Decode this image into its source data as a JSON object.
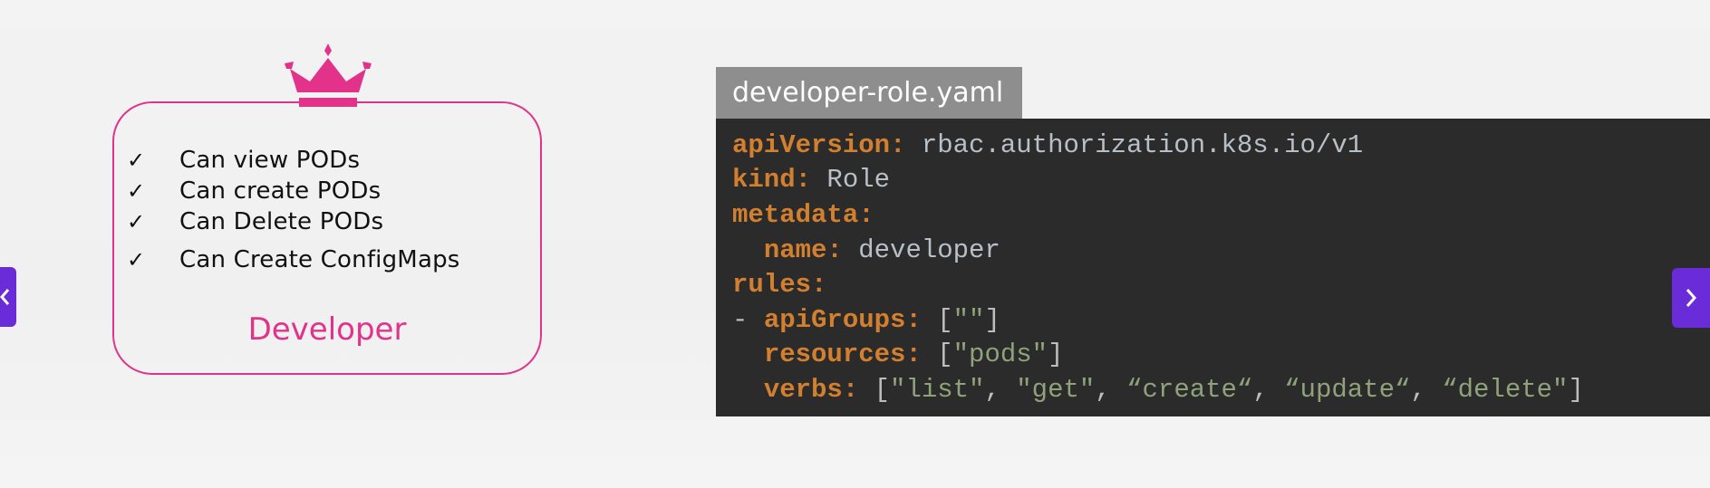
{
  "role": {
    "title": "Developer",
    "permissions": [
      "Can view PODs",
      "Can create PODs",
      "Can Delete PODs",
      "Can Create ConfigMaps"
    ],
    "check_glyph": "✓",
    "accent_color": "#e3328a",
    "icon": "crown-icon"
  },
  "file": {
    "name": "developer-role.yaml"
  },
  "code": {
    "api_version_key": "apiVersion:",
    "api_version_value": "rbac.authorization.k8s.io/v1",
    "kind_key": "kind:",
    "kind_value": "Role",
    "metadata_key": "metadata:",
    "name_key": "name:",
    "name_value": "developer",
    "rules_key": "rules:",
    "dash": "- ",
    "api_groups_key": "apiGroups:",
    "api_groups_open": "[",
    "api_groups_value": "\"\"",
    "api_groups_close": "]",
    "resources_key": "resources:",
    "resources_open": "[",
    "resources_value": "\"pods\"",
    "resources_close": "]",
    "verbs_key": "verbs:",
    "verbs_open": "[",
    "verbs": [
      "\"list\"",
      "\"get\"",
      "“create“",
      "“update“",
      "“delete\""
    ],
    "verbs_sep": ", ",
    "verbs_close": "]",
    "colors": {
      "key": "#d2802f",
      "value": "#b8bfc6",
      "string": "#8fa27a",
      "background": "#2b2b2b",
      "tab": "#8e8e8e"
    }
  },
  "nav": {
    "prev_icon": "chevron-left-icon",
    "next_icon": "chevron-right-icon",
    "color": "#6a2bd8"
  }
}
